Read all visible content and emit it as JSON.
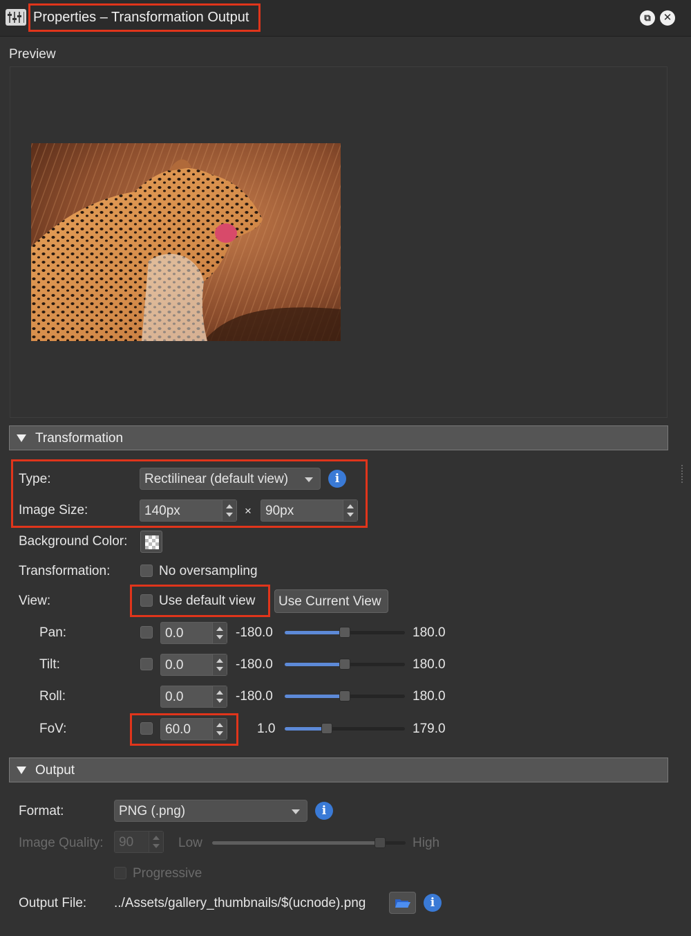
{
  "window": {
    "title": "Properties – Transformation Output"
  },
  "preview": {
    "label": "Preview"
  },
  "transformation_section": {
    "title": "Transformation"
  },
  "fields": {
    "type_label": "Type:",
    "type_value": "Rectilinear (default view)",
    "image_size_label": "Image Size:",
    "width_value": "140px",
    "times": "×",
    "height_value": "90px",
    "bg_color_label": "Background Color:",
    "transformation_label": "Transformation:",
    "no_oversampling_label": "No oversampling",
    "view_label": "View:",
    "use_default_view_label": "Use default view",
    "use_current_view_button": "Use Current View"
  },
  "view_params": [
    {
      "label": "Pan:",
      "has_checkbox": true,
      "value": "0.0",
      "min": "-180.0",
      "max": "180.0",
      "position": 0.5
    },
    {
      "label": "Tilt:",
      "has_checkbox": true,
      "value": "0.0",
      "min": "-180.0",
      "max": "180.0",
      "position": 0.5
    },
    {
      "label": "Roll:",
      "has_checkbox": false,
      "value": "0.0",
      "min": "-180.0",
      "max": "180.0",
      "position": 0.5
    },
    {
      "label": "FoV:",
      "has_checkbox": true,
      "value": "60.0",
      "min": "1.0",
      "max": "179.0",
      "position": 0.33
    }
  ],
  "output_section": {
    "title": "Output"
  },
  "output": {
    "format_label": "Format:",
    "format_value": "PNG (.png)",
    "quality_label": "Image Quality:",
    "quality_value": "90",
    "quality_low": "Low",
    "quality_high": "High",
    "quality_position": 0.88,
    "progressive_label": "Progressive",
    "output_file_label": "Output File:",
    "output_file_value": "../Assets/gallery_thumbnails/$(ucnode).png"
  },
  "icons": {
    "app": "properties-icon",
    "restore": "restore-window-icon",
    "close": "close-icon",
    "info": "info-icon",
    "folder": "folder-open-icon"
  },
  "colors": {
    "accent": "#3a7ad6",
    "highlight_box": "#e0351b",
    "slider_fill": "#5d8ad8"
  }
}
